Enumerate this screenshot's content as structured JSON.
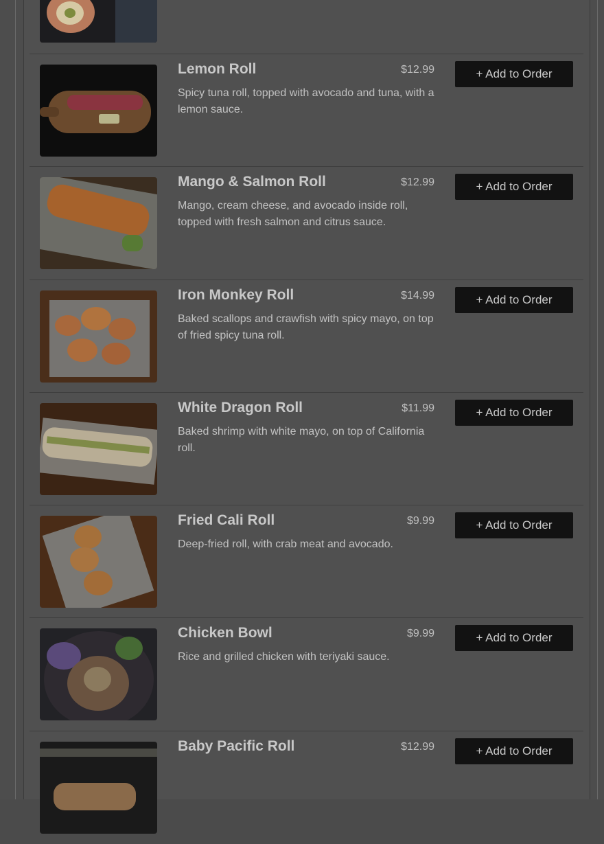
{
  "menu": {
    "add_label": "+ Add to Order",
    "items": [
      {
        "title": "",
        "price": "",
        "desc": ""
      },
      {
        "title": "Lemon Roll",
        "price": "$12.99",
        "desc": "Spicy tuna roll, topped with avocado and tuna, with a lemon sauce."
      },
      {
        "title": "Mango & Salmon Roll",
        "price": "$12.99",
        "desc": "Mango, cream cheese, and avocado inside roll, topped with fresh salmon and citrus sauce."
      },
      {
        "title": "Iron Monkey Roll",
        "price": "$14.99",
        "desc": "Baked scallops and crawfish with spicy mayo, on top of fried spicy tuna roll."
      },
      {
        "title": "White Dragon Roll",
        "price": "$11.99",
        "desc": "Baked shrimp with white mayo, on top of California roll."
      },
      {
        "title": "Fried Cali Roll",
        "price": "$9.99",
        "desc": "Deep-fried roll, with crab meat and avocado."
      },
      {
        "title": "Chicken Bowl",
        "price": "$9.99",
        "desc": "Rice and grilled chicken with teriyaki sauce."
      },
      {
        "title": "Baby Pacific Roll",
        "price": "$12.99",
        "desc": ""
      }
    ]
  },
  "colors": {
    "overlay": "#4d4d4d",
    "button_bg": "#121212",
    "text": "#c8c8c8"
  }
}
